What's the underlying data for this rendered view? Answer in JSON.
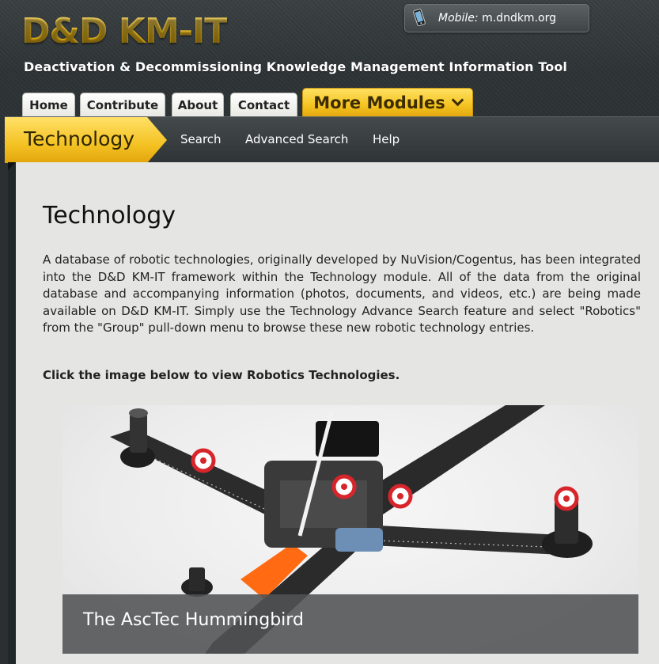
{
  "brand": {
    "logo": "D&D KM-IT",
    "subtitle": "Deactivation & Decommissioning Knowledge Management Information Tool"
  },
  "mobile": {
    "label": "Mobile:",
    "url": "m.dndkm.org",
    "icon": "phone-icon"
  },
  "tabs": [
    {
      "label": "Home"
    },
    {
      "label": "Contribute"
    },
    {
      "label": "About"
    },
    {
      "label": "Contact"
    },
    {
      "label": "More Modules"
    }
  ],
  "module": {
    "title": "Technology",
    "links": [
      {
        "label": "Search"
      },
      {
        "label": "Advanced Search"
      },
      {
        "label": "Help"
      }
    ]
  },
  "main": {
    "heading": "Technology",
    "description": "A database of robotic technologies, originally developed by NuVision/Cogentus, has been integrated into the D&D KM-IT framework within the Technology module. All of the data from the original database and accompanying information (photos, documents, and videos, etc.) are being made available on D&D KM-IT. Simply use the Technology Advance Search feature and select \"Robotics\" from the \"Group\" pull-down menu to browse these new robotic technology entries.",
    "cta": "Click the image below to view Robotics Technologies.",
    "image_caption": "The AscTec Hummingbird"
  },
  "colors": {
    "accent_gold": "#f2c020",
    "header_dark": "#2d3335",
    "content_bg": "#e5e6e3",
    "marker_red": "#d7262b"
  }
}
